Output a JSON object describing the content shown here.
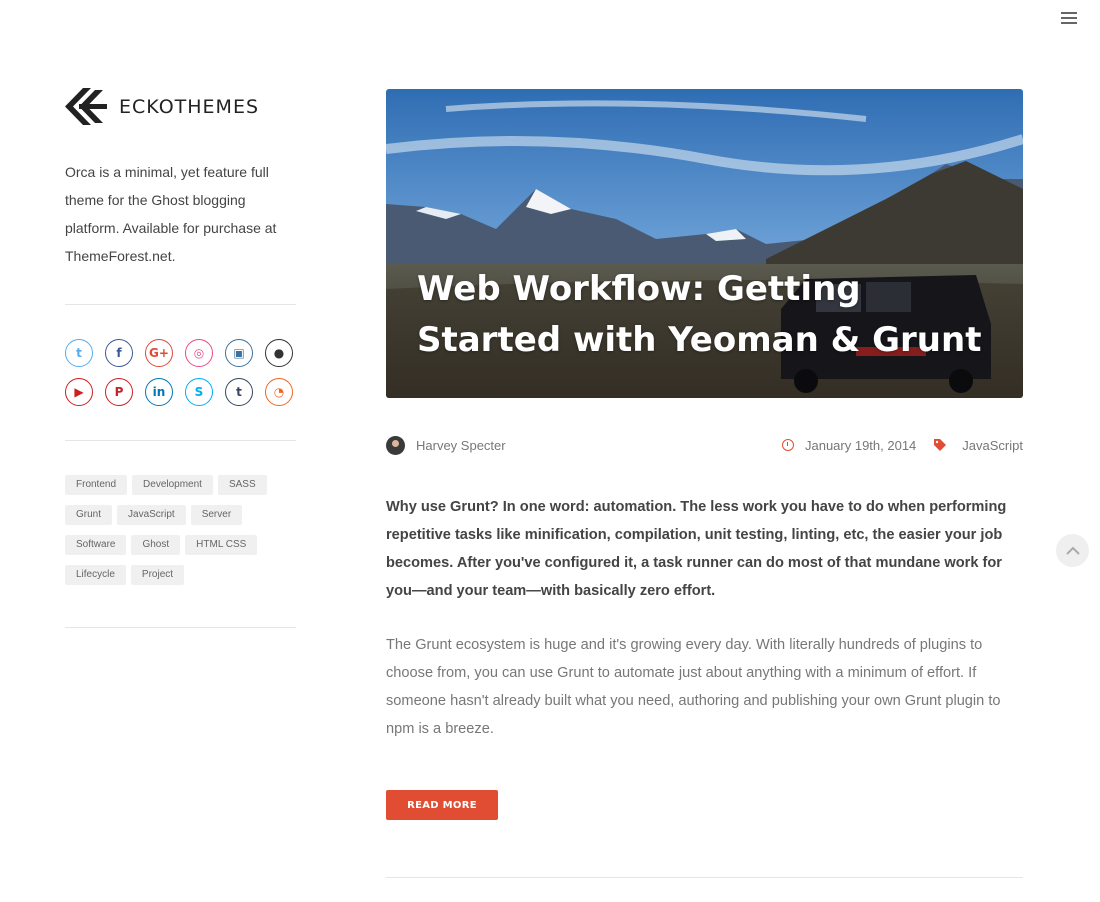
{
  "brand": {
    "name": "ECKOTHEMES"
  },
  "sidebar": {
    "blurb": "Orca is a minimal, yet feature full theme for the Ghost blogging platform. Available for purchase at ThemeForest.net.",
    "socials": [
      {
        "name": "twitter-icon",
        "glyph": "t",
        "color": "#55acee"
      },
      {
        "name": "facebook-icon",
        "glyph": "f",
        "color": "#3b5998"
      },
      {
        "name": "google-plus-icon",
        "glyph": "G+",
        "color": "#dd4b39"
      },
      {
        "name": "dribbble-icon",
        "glyph": "◎",
        "color": "#ea4c89"
      },
      {
        "name": "instagram-icon",
        "glyph": "▣",
        "color": "#3f729b"
      },
      {
        "name": "github-icon",
        "glyph": "●",
        "color": "#333333"
      },
      {
        "name": "youtube-icon",
        "glyph": "▶",
        "color": "#cd201f"
      },
      {
        "name": "pinterest-icon",
        "glyph": "P",
        "color": "#cb2027"
      },
      {
        "name": "linkedin-icon",
        "glyph": "in",
        "color": "#0077b5"
      },
      {
        "name": "skype-icon",
        "glyph": "S",
        "color": "#00aff0"
      },
      {
        "name": "tumblr-icon",
        "glyph": "t",
        "color": "#35465c"
      },
      {
        "name": "rss-icon",
        "glyph": "◔",
        "color": "#f26522"
      }
    ],
    "tags": [
      "Frontend",
      "Development",
      "SASS",
      "Grunt",
      "JavaScript",
      "Server",
      "Software",
      "Ghost",
      "HTML CSS",
      "Lifecycle",
      "Project"
    ]
  },
  "post": {
    "title": "Web Workflow: Getting Started with Yeoman & Grunt",
    "author": "Harvey Specter",
    "date": "January 19th, 2014",
    "category": "JavaScript",
    "lead": "Why use Grunt? In one word: automation. The less work you have to do when performing repetitive tasks like minification, compilation, unit testing, linting, etc, the easier your job becomes. After you've configured it, a task runner can do most of that mundane work for you—and your team—with basically zero effort.",
    "body": "The Grunt ecosystem is huge and it's growing every day. With literally hundreds of plugins to choose from, you can use Grunt to automate just about anything with a minimum of effort. If someone hasn't already built what you need, authoring and publishing your own Grunt plugin to npm is a breeze.",
    "read_more": "READ MORE"
  },
  "colors": {
    "accent": "#e14d33"
  }
}
